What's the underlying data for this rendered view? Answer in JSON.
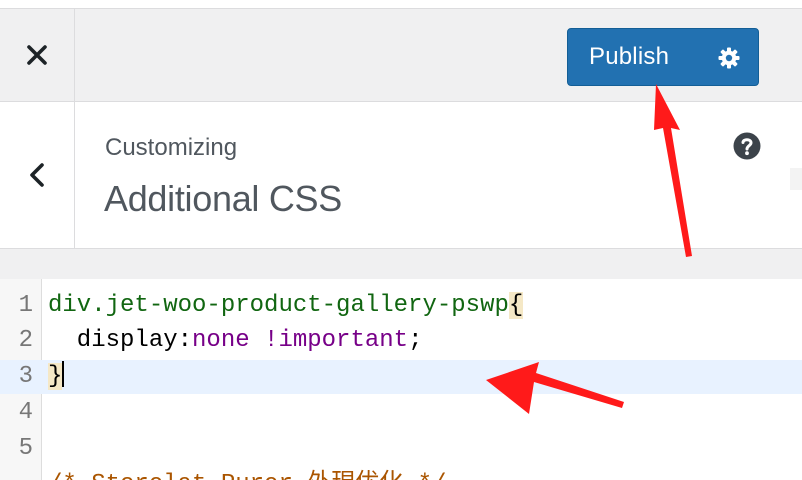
{
  "header": {
    "close_label": "Close",
    "publish_label": "Publish"
  },
  "section": {
    "breadcrumb": "Customizing",
    "title": "Additional CSS"
  },
  "editor": {
    "line_numbers": [
      "1",
      "2",
      "3",
      "4",
      "5"
    ],
    "lines": {
      "l1_selector": "div.jet-woo-product-gallery-pswp",
      "l1_brace": "{",
      "l2_prop": "  display:",
      "l2_value": "none !important",
      "l2_semicolon": ";",
      "l3_brace": "}",
      "l6_partial": "/* Storelat Purer 外現优化 */"
    }
  },
  "colors": {
    "publish_bg": "#2271b1",
    "header_bg": "#f0f0f1",
    "active_line_bg": "#e8f2ff",
    "annotation_arrow": "#ff0000"
  },
  "icons": {
    "close": "close-icon",
    "gear": "gear-icon",
    "back": "chevron-left-icon",
    "help": "help-icon"
  }
}
